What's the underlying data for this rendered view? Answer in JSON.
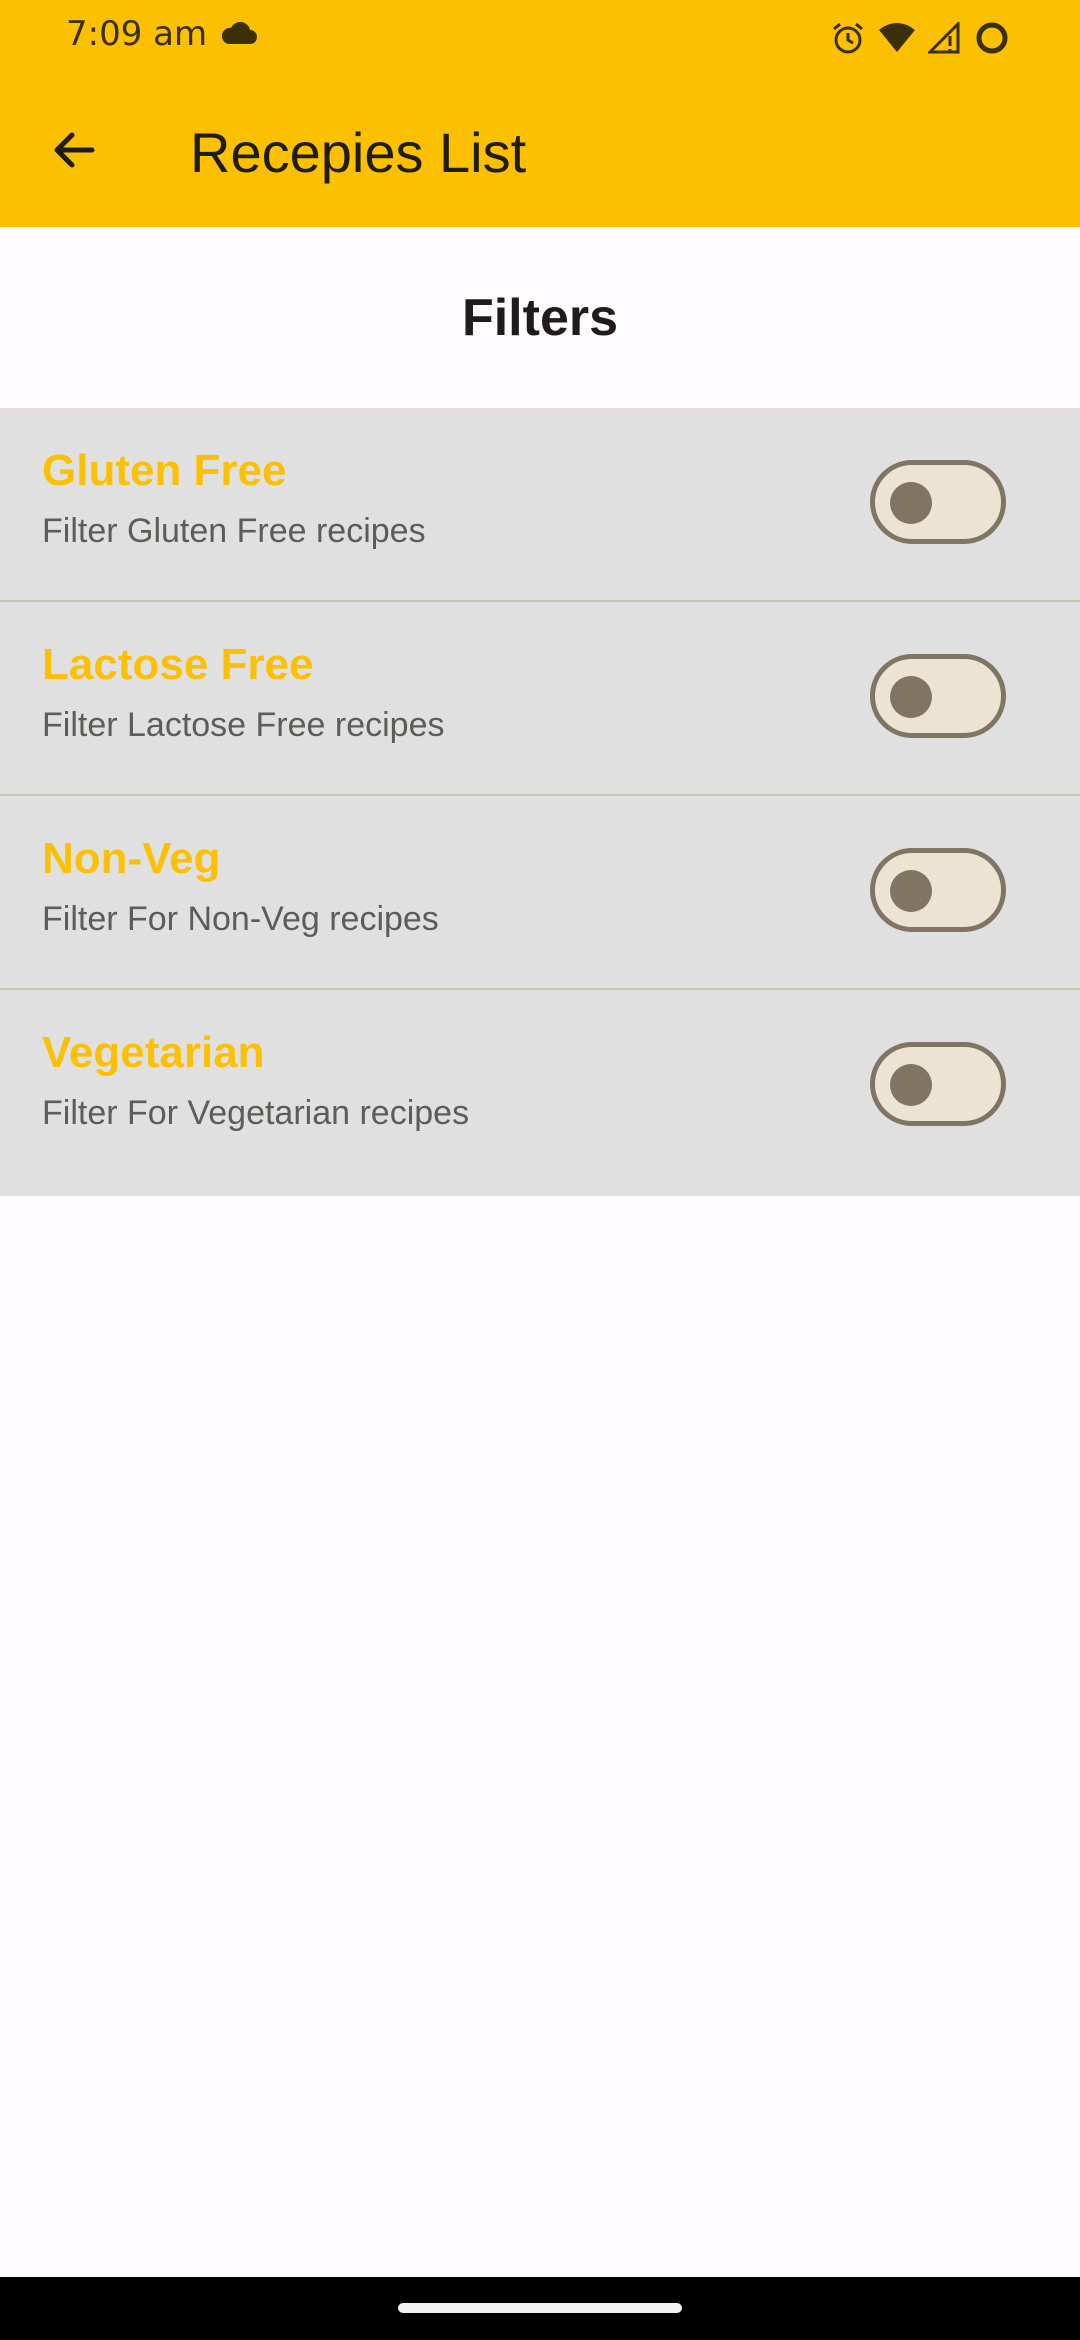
{
  "status_bar": {
    "time": "7:09 am",
    "left_icons": [
      "cloud-icon"
    ],
    "right_icons": [
      "alarm-icon",
      "wifi-icon",
      "signal-icon",
      "battery-icon"
    ]
  },
  "toolbar": {
    "back_icon": "arrow-left-icon",
    "title": "Recepies List"
  },
  "page": {
    "heading": "Filters"
  },
  "filters": [
    {
      "title": "Gluten Free",
      "subtitle": "Filter Gluten Free recipes",
      "enabled": false
    },
    {
      "title": "Lactose Free",
      "subtitle": "Filter Lactose Free recipes",
      "enabled": false
    },
    {
      "title": "Non-Veg",
      "subtitle": "Filter For Non-Veg recipes",
      "enabled": false
    },
    {
      "title": "Vegetarian",
      "subtitle": "Filter For Vegetarian recipes",
      "enabled": false
    }
  ],
  "colors": {
    "accent": "#fbc002",
    "list_background": "#e0e0e0",
    "switch_track": "#ede3d2",
    "switch_thumb": "#807463"
  }
}
